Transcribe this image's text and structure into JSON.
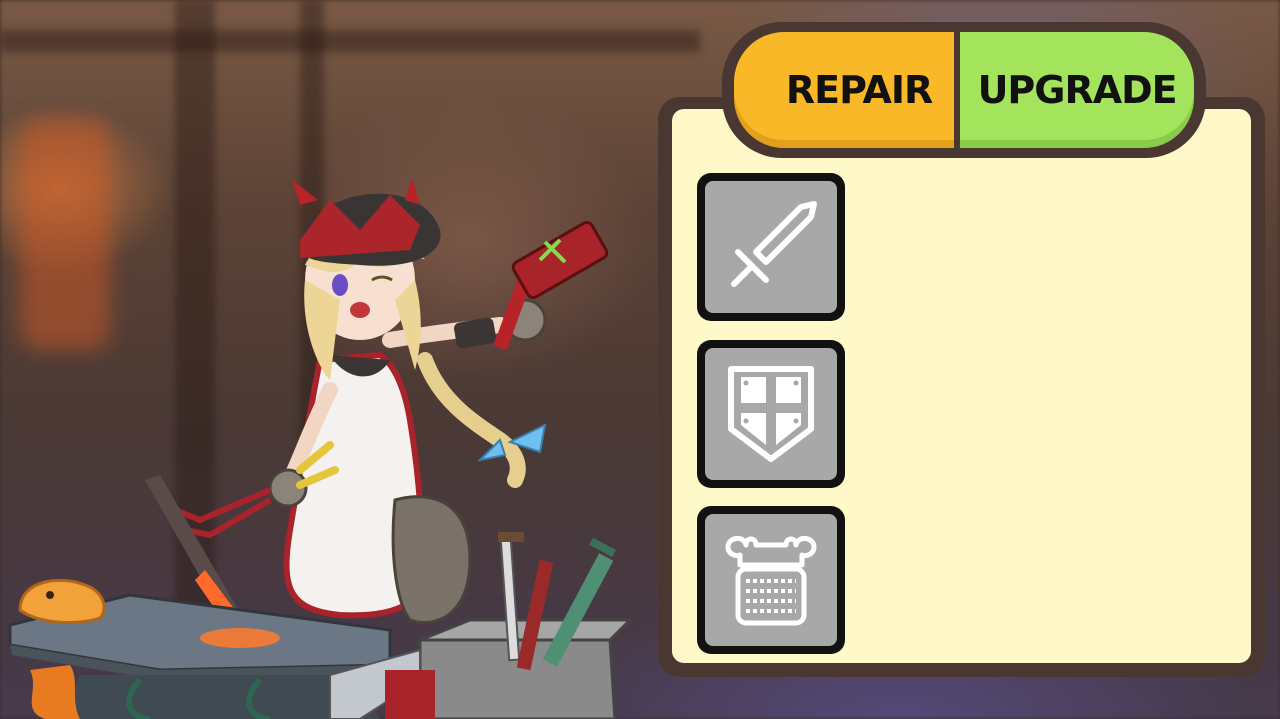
{
  "tabs": {
    "repair_label": "REPAIR",
    "upgrade_label": "UPGRADE",
    "repair_color": "#f8b828",
    "upgrade_color": "#a4e45c"
  },
  "panel": {
    "background": "#fff8c8",
    "slots": [
      {
        "icon": "sword-icon"
      },
      {
        "icon": "shield-icon"
      },
      {
        "icon": "armor-icon"
      }
    ]
  },
  "scene": {
    "character": "blacksmith-girl",
    "props": [
      "hammer",
      "tongs",
      "anvil",
      "heated-blade",
      "weapon-crate",
      "orange-slime"
    ]
  }
}
